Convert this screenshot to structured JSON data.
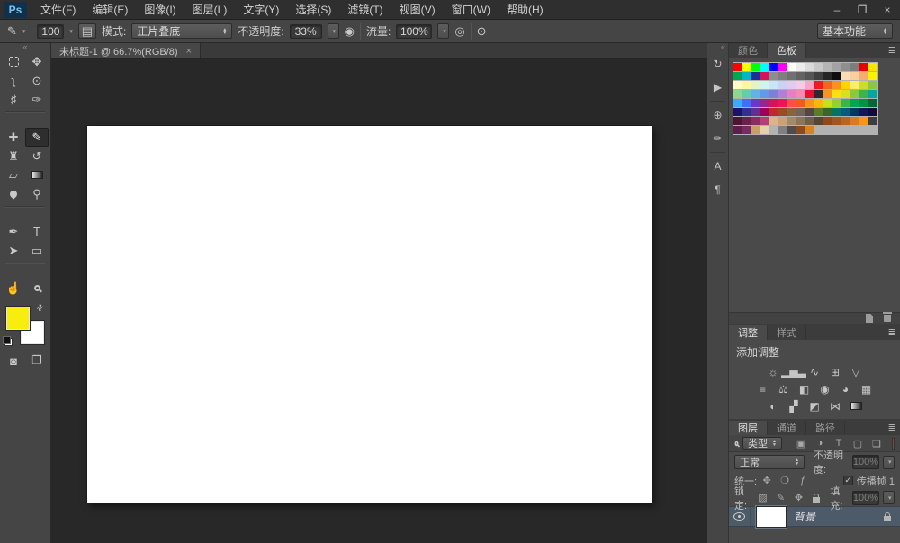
{
  "window_controls": {
    "minimize": "–",
    "restore": "❐",
    "close": "×"
  },
  "menu": {
    "logo": "Ps",
    "items": [
      {
        "id": "file",
        "label": "文件(F)"
      },
      {
        "id": "edit",
        "label": "编辑(E)"
      },
      {
        "id": "image",
        "label": "图像(I)"
      },
      {
        "id": "layer",
        "label": "图层(L)"
      },
      {
        "id": "type",
        "label": "文字(Y)"
      },
      {
        "id": "select",
        "label": "选择(S)"
      },
      {
        "id": "filter",
        "label": "滤镜(T)"
      },
      {
        "id": "view",
        "label": "视图(V)"
      },
      {
        "id": "window",
        "label": "窗口(W)"
      },
      {
        "id": "help",
        "label": "帮助(H)"
      }
    ]
  },
  "options": {
    "brush_preset_icon": "✎",
    "brush_size": "100",
    "brush_panel_icon": "▤",
    "mode_label": "模式:",
    "mode_value": "正片叠底",
    "opacity_label": "不透明度:",
    "opacity_value": "33%",
    "pressure_opacity_icon": "◉",
    "flow_label": "流量:",
    "flow_value": "100%",
    "airbrush_icon": "◎",
    "pressure_size_icon": "⊙",
    "workspace_value": "基本功能"
  },
  "toolbar": {
    "collapse_icon": "«",
    "tools": [
      {
        "name": "rectangular-marquee",
        "kind": "marquee"
      },
      {
        "name": "move",
        "glyph": "✥"
      },
      {
        "name": "lasso",
        "glyph": "ʅ"
      },
      {
        "name": "quick-selection",
        "glyph": "⊙"
      },
      {
        "name": "crop",
        "glyph": "♯"
      },
      {
        "name": "eyedropper",
        "glyph": "✑"
      },
      {
        "divider": true
      },
      {
        "name": "spot-healing-brush",
        "glyph": "✚"
      },
      {
        "name": "brush",
        "glyph": "✎",
        "selected": true
      },
      {
        "name": "clone-stamp",
        "glyph": "♜"
      },
      {
        "name": "history-brush",
        "glyph": "↺"
      },
      {
        "name": "eraser",
        "glyph": "▱"
      },
      {
        "name": "gradient",
        "kind": "gradient"
      },
      {
        "name": "blur",
        "kind": "drop"
      },
      {
        "name": "dodge",
        "glyph": "⚲"
      },
      {
        "divider": true
      },
      {
        "name": "pen",
        "glyph": "✒"
      },
      {
        "name": "type",
        "glyph": "T"
      },
      {
        "name": "path-selection",
        "glyph": "➤"
      },
      {
        "name": "rectangle",
        "glyph": "▭"
      },
      {
        "divider": true
      },
      {
        "name": "hand",
        "glyph": "☝"
      },
      {
        "name": "zoom",
        "kind": "magnifier"
      }
    ],
    "swap_icon": "⇄",
    "foreground_color": "#f7ee0f",
    "background_color": "#ffffff",
    "quick_mask_icon": "◙",
    "screen_mode_icon": "❐"
  },
  "document": {
    "tab_title": "未标题-1 @ 66.7%(RGB/8)",
    "tab_close": "×"
  },
  "dock_strip": {
    "collapse_icon": "«",
    "icons": [
      {
        "name": "history-panel",
        "glyph": "↻"
      },
      {
        "name": "actions-panel",
        "glyph": "▶"
      },
      {
        "divider": true
      },
      {
        "name": "clone-source-panel",
        "glyph": "⊕"
      },
      {
        "name": "brush-presets-panel",
        "glyph": "✏"
      },
      {
        "divider": true
      },
      {
        "name": "character-panel",
        "glyph": "A"
      },
      {
        "name": "paragraph-panel",
        "glyph": "¶"
      }
    ]
  },
  "swatches_panel": {
    "tabs": [
      {
        "id": "color",
        "label": "颜色",
        "active": false
      },
      {
        "id": "swatches",
        "label": "色板",
        "active": true
      }
    ],
    "menu_icon": "≣",
    "rows": [
      [
        "#ff0000",
        "#ffff00",
        "#00ff00",
        "#00ffff",
        "#0000ff",
        "#ff00ff",
        "#ffffff",
        "#ececec",
        "#dadada",
        "#c8c8c8",
        "#b4b4b4",
        "#a2a2a2",
        "#8f8f8f",
        "#7d7d7d",
        "#e80000",
        "#ffe400"
      ],
      [
        "#00a651",
        "#00b6c9",
        "#1c2f99",
        "#d4145a",
        "#8d8d8d",
        "#7f7f7f",
        "#717171",
        "#636363",
        "#555555",
        "#404040",
        "#262626",
        "#0d0d0d",
        "#fbdcb6",
        "#f9cf9f",
        "#f5ae6f",
        "#fff200"
      ],
      [
        "#fffbc9",
        "#fff6a4",
        "#e3f5c4",
        "#d2f4ee",
        "#c5e7f8",
        "#cbd3f4",
        "#e1cbf1",
        "#f6cbe6",
        "#f6a7c8",
        "#ed1c24",
        "#f26522",
        "#f7941d",
        "#ffd400",
        "#faf067",
        "#cddc29",
        "#8dc63f"
      ],
      [
        "#8cd98c",
        "#66cdaa",
        "#64b2e5",
        "#6598e5",
        "#7f7fd8",
        "#b27fd8",
        "#e57fc8",
        "#f28ab2",
        "#e8112d",
        "#2b2b2b",
        "#f7941d",
        "#ffde17",
        "#d9e021",
        "#8dc63f",
        "#39b54a",
        "#00a99d"
      ],
      [
        "#3fa9f5",
        "#3f6ff5",
        "#6639c9",
        "#93278f",
        "#d4145a",
        "#ed145b",
        "#ff4d4d",
        "#f15a24",
        "#f7931e",
        "#ffb30f",
        "#c8e01e",
        "#9acd32",
        "#39b54a",
        "#00a651",
        "#009245",
        "#006837"
      ],
      [
        "#1b1464",
        "#2e3192",
        "#662d91",
        "#9e005d",
        "#c1272d",
        "#9e4a21",
        "#8c6239",
        "#736357",
        "#534741",
        "#5e7d23",
        "#3a6629",
        "#00746b",
        "#005b7f",
        "#003663",
        "#14145c",
        "#0d0d3d"
      ],
      [
        "#4d1434",
        "#6b1f4b",
        "#8a2b63",
        "#b04373",
        "#d9b48f",
        "#c7a27c",
        "#a38a6a",
        "#8a765b",
        "#6e5f4b",
        "#52483a",
        "#8c4a1f",
        "#a0561f",
        "#b9641f",
        "#d97b21",
        "#f7941d",
        "#3d3d3d"
      ],
      [
        "#5c1f4b",
        "#7a2963",
        "#c9a063",
        "#e6d2a8",
        "#b3b3b3",
        "#808080",
        "#4d4d4d",
        "#8c4a1f",
        "#d9821f"
      ]
    ]
  },
  "adjustments_panel": {
    "tabs": [
      {
        "id": "adjustments",
        "label": "调整",
        "active": true
      },
      {
        "id": "styles",
        "label": "样式",
        "active": false
      }
    ],
    "menu_icon": "≣",
    "hint": "添加调整",
    "rows": [
      [
        {
          "name": "brightness-contrast",
          "glyph": "☼"
        },
        {
          "name": "levels",
          "glyph": "▂▅▃"
        },
        {
          "name": "curves",
          "glyph": "∿"
        },
        {
          "name": "exposure",
          "glyph": "⊞"
        },
        {
          "name": "vibrance",
          "glyph": "▽"
        }
      ],
      [
        {
          "name": "hue-saturation",
          "glyph": "≡"
        },
        {
          "name": "color-balance",
          "glyph": "⚖"
        },
        {
          "name": "black-white",
          "glyph": "◧"
        },
        {
          "name": "photo-filter",
          "glyph": "◉"
        },
        {
          "name": "channel-mixer",
          "glyph": "◕"
        },
        {
          "name": "color-lookup",
          "glyph": "▦"
        }
      ],
      [
        {
          "name": "invert",
          "glyph": "◐"
        },
        {
          "name": "posterize",
          "glyph": "▞"
        },
        {
          "name": "threshold",
          "glyph": "◩"
        },
        {
          "name": "selective-color",
          "glyph": "⋈"
        },
        {
          "name": "gradient-map",
          "kind": "gradient"
        }
      ]
    ]
  },
  "layers_panel": {
    "tabs": [
      {
        "id": "layers",
        "label": "图层",
        "active": true
      },
      {
        "id": "channels",
        "label": "通道",
        "active": false
      },
      {
        "id": "paths",
        "label": "路径",
        "active": false
      }
    ],
    "menu_icon": "≣",
    "filter": {
      "kind_value": "类型",
      "icons": [
        {
          "name": "filter-image",
          "glyph": "▣"
        },
        {
          "name": "filter-adjustment",
          "glyph": "◑"
        },
        {
          "name": "filter-type",
          "glyph": "T"
        },
        {
          "name": "filter-shape",
          "glyph": "▢"
        },
        {
          "name": "filter-smart-object",
          "glyph": "❏"
        }
      ]
    },
    "blend": {
      "value": "正常",
      "opacity_label": "不透明度:",
      "opacity_value": "100%"
    },
    "unify": {
      "label": "统一:",
      "icons": [
        {
          "name": "unify-position",
          "glyph": "✥"
        },
        {
          "name": "unify-visibility",
          "glyph": "❍"
        },
        {
          "name": "unify-style",
          "glyph": "ƒ"
        }
      ],
      "check": "✓",
      "propagate_label": "传播帧 1"
    },
    "lock": {
      "label": "锁定:",
      "icons": [
        {
          "name": "lock-transparency",
          "glyph": "▨"
        },
        {
          "name": "lock-image",
          "glyph": "✎"
        },
        {
          "name": "lock-position",
          "glyph": "✥"
        },
        {
          "name": "lock-all",
          "kind": "padlock"
        }
      ],
      "fill_label": "填充:",
      "fill_value": "100%"
    },
    "layers": [
      {
        "name": "背景",
        "visible": true,
        "locked": true,
        "selected": true,
        "thumb": "#ffffff"
      }
    ]
  }
}
